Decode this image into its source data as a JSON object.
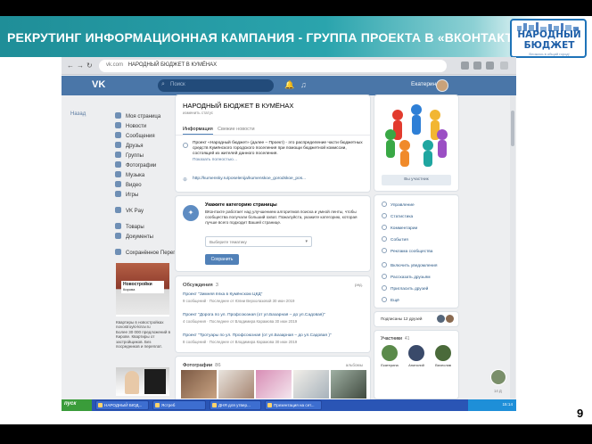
{
  "slide": {
    "title": "РЕКРУТИНГ ИНФОРМАЦИОННАЯ КАМПАНИЯ - ГРУППА ПРОЕКТА В «ВКОНТАКТЕ»",
    "page_number": "9",
    "logo": {
      "line1": "НАРОДНЫЙ",
      "line2": "БЮДЖЕТ",
      "tagline": "Вложись в общий город!"
    },
    "colors": {
      "header_start": "#1f8e98",
      "header_end": "#8cd0d4",
      "vk_blue": "#4a76a8",
      "logo_blue": "#1e5fa8"
    }
  },
  "browser": {
    "back_label": "←",
    "forward_label": "→",
    "reload_label": "↻",
    "url_host": "vk.com",
    "url_title": "НАРОДНЫЙ БЮДЖЕТ В КУМЁНАХ"
  },
  "vk": {
    "logo": "VK",
    "search_placeholder": "Поиск",
    "user_name": "Екатерина",
    "back_link": "Назад",
    "menu": [
      {
        "label": "Моя страница",
        "icon": "home-icon"
      },
      {
        "label": "Новости",
        "icon": "news-icon"
      },
      {
        "label": "Сообщения",
        "icon": "messages-icon"
      },
      {
        "label": "Друзья",
        "icon": "friends-icon"
      },
      {
        "label": "Группы",
        "icon": "groups-icon"
      },
      {
        "label": "Фотографии",
        "icon": "photos-icon"
      },
      {
        "label": "Музыка",
        "icon": "music-icon"
      },
      {
        "label": "Видео",
        "icon": "video-icon"
      },
      {
        "label": "Игры",
        "icon": "games-icon"
      },
      {
        "label": "VK Pay",
        "icon": "vkpay-icon"
      },
      {
        "label": "Товары",
        "icon": "goods-icon"
      },
      {
        "label": "Документы",
        "icon": "documents-icon"
      },
      {
        "label": "Сохранённое Перего...",
        "icon": "bookmarks-icon"
      }
    ],
    "ad": {
      "brand": "Новостройки",
      "city": "Кирова",
      "text": "Квартиры в новостройках novostroyki-kirov.ru\nБолее 30 000 предложений в Кирове. Квартиры от застройщиков. Без посредников и переплат."
    },
    "group": {
      "name": "НАРОДНЫЙ БЮДЖЕТ В КУМЁНАХ",
      "status": "изменить статус",
      "tabs": [
        "Информация",
        "Свежие новости"
      ],
      "description": "Проект «Народный бюджет» (далее – Проект) - это распределение части бюджетных средств Кумёнского городского поселения при помощи бюджетной комиссии, состоящей из жителей данного поселения.",
      "more_label": "Показать полностью…",
      "site": "http://kumensky.ru/poselenija/kumenskoe_gorodskoe_pos..."
    },
    "category": {
      "title": "Укажите категорию страницы",
      "text": "ВКонтакте работает над улучшением алгоритмов поиска и умной ленты, чтобы сообщества получали больший охват. Пожалуйста, укажите категорию, которая лучше всего подходит Вашей странице.",
      "select_placeholder": "Выберите тематику",
      "button": "Сохранить"
    },
    "discussions": {
      "title": "Обсуждения",
      "count": "3",
      "right_label": "ред.",
      "topics": [
        {
          "title": "Проект \"Зимняя ёлка в Кумёнском ЦКД\"",
          "meta": "9 сообщений · Последнее от Юлии Верхолазовой 30 июн 2019"
        },
        {
          "title": "Проект \"Дорога по ул. Профсоюзная (от ул.Базарная – до ул.Садовая)\"",
          "meta": "4 сообщения · Последнее от Владимира Карамова 30 июн 2019"
        },
        {
          "title": "Проект \"Тротуары по ул. Профсоюзная (от ул.Базарная – до ул.Садовая )\"",
          "meta": "8 сообщений · Последнее от Владимира Карамова 30 июн 2019"
        }
      ]
    },
    "photos": {
      "title": "Фотографии",
      "count": "86",
      "right_label": "альбомы"
    },
    "subscribe_label": "Вы участник",
    "actions": [
      {
        "label": "Управление",
        "icon": "settings-icon"
      },
      {
        "label": "Статистика",
        "icon": "stats-icon"
      },
      {
        "label": "Комментарии",
        "icon": "comments-icon"
      },
      {
        "label": "События",
        "icon": "events-icon"
      },
      {
        "label": "Реклама сообщества",
        "icon": "ads-icon"
      },
      {
        "label": "Включить уведомления",
        "icon": "bell-icon"
      },
      {
        "label": "Рассказать друзьям",
        "icon": "share-icon"
      },
      {
        "label": "Пригласить друзей",
        "icon": "invite-icon"
      },
      {
        "label": "Ещё",
        "icon": "more-icon"
      }
    ],
    "friends_label": "Подписаны 12 друзей",
    "members": {
      "title": "Участники",
      "count": "41",
      "people": [
        {
          "name": "Екатерина",
          "color": "#5a8a4a"
        },
        {
          "name": "Анатолий",
          "color": "#3a4a6a"
        },
        {
          "name": "Вячеслав",
          "color": "#4a6a3a"
        }
      ]
    },
    "chat_count": "14 Д",
    "taskbar": {
      "start": "пуск",
      "tasks": [
        "НАРОДНЫЙ БЮД...",
        "Ястреб",
        "ДНЯ для утвер...",
        "Презентация на сет..."
      ],
      "clock": "15:14"
    }
  }
}
